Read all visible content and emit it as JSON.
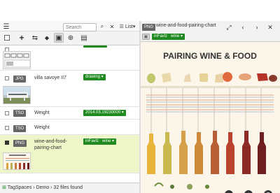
{
  "left_toolbar": {
    "search_placeholder": "Search",
    "view_label": "List"
  },
  "files": [
    {
      "ext": "",
      "name": "",
      "tags": []
    },
    {
      "ext": "JPG",
      "name": "villa savoye II7",
      "tags": [
        {
          "label": "drawing"
        }
      ]
    },
    {
      "ext": "TSO",
      "name": "Weight",
      "tags": [
        {
          "label": "2014.03.19230000"
        }
      ]
    },
    {
      "ext": "TSO",
      "name": "Weight",
      "tags": []
    },
    {
      "ext": "PNG",
      "name": "wine-and-food-pairing-chart",
      "tags": [
        {
          "label": "inFavlz"
        },
        {
          "label": "wine"
        }
      ]
    }
  ],
  "status": {
    "text": "TagSpaces › Demo › 32 files found"
  },
  "viewer": {
    "ext": "PNG",
    "filename": "wine-and-food-pairing-chart",
    "tags": [
      {
        "label": "inFavlz"
      },
      {
        "label": "wine"
      }
    ]
  },
  "poster": {
    "title": "PAIRING WINE & FOOD"
  },
  "colors": {
    "tag_green": "#1f8a1f",
    "selected_row": "#eef5c8",
    "poster_bg": "#fbf6e9",
    "poster_title": "#333333"
  }
}
